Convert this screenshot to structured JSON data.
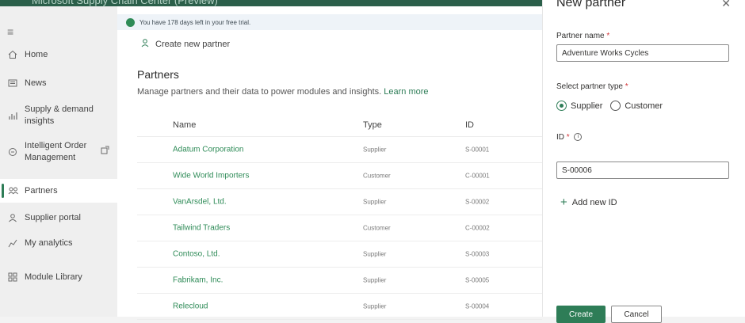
{
  "app": {
    "title": "Microsoft Supply Chain Center (Preview)"
  },
  "nav": {
    "items": [
      {
        "label": "Home",
        "icon": "home-icon"
      },
      {
        "label": "News",
        "icon": "news-icon"
      },
      {
        "label": "Supply & demand insights",
        "icon": "insights-icon"
      },
      {
        "label": "Intelligent Order Management",
        "icon": "order-management-icon"
      },
      {
        "label": "Partners",
        "icon": "partners-icon",
        "active": true
      },
      {
        "label": "Supplier portal",
        "icon": "supplier-portal-icon"
      },
      {
        "label": "My analytics",
        "icon": "analytics-icon"
      },
      {
        "label": "Module Library",
        "icon": "module-library-icon"
      }
    ]
  },
  "banner": {
    "text": "You have 178 days left in your free trial."
  },
  "toolbar": {
    "create_label": "Create new partner"
  },
  "page": {
    "title": "Partners",
    "subtitle": "Manage partners and their data to power modules and insights.",
    "learn_more": "Learn more"
  },
  "table": {
    "columns": [
      "Name",
      "Type",
      "ID"
    ],
    "rows": [
      {
        "name": "Adatum Corporation",
        "type": "Supplier",
        "id": "S-00001"
      },
      {
        "name": "Wide World Importers",
        "type": "Customer",
        "id": "C-00001"
      },
      {
        "name": "VanArsdel, Ltd.",
        "type": "Supplier",
        "id": "S-00002"
      },
      {
        "name": "Tailwind Traders",
        "type": "Customer",
        "id": "C-00002"
      },
      {
        "name": "Contoso, Ltd.",
        "type": "Supplier",
        "id": "S-00003"
      },
      {
        "name": "Fabrikam, Inc.",
        "type": "Supplier",
        "id": "S-00005"
      },
      {
        "name": "Relecloud",
        "type": "Supplier",
        "id": "S-00004"
      }
    ]
  },
  "panel": {
    "title": "New partner",
    "partner_name_label": "Partner name",
    "partner_name_value": "Adventure Works Cycles",
    "partner_type_label": "Select partner type",
    "type_options": [
      "Supplier",
      "Customer"
    ],
    "selected_type": "Supplier",
    "id_label": "ID",
    "id_value": "S-00006",
    "add_id_label": "Add new ID",
    "create_label": "Create",
    "cancel_label": "Cancel"
  },
  "colors": {
    "accent": "#2e7d57",
    "required": "#d13438"
  }
}
